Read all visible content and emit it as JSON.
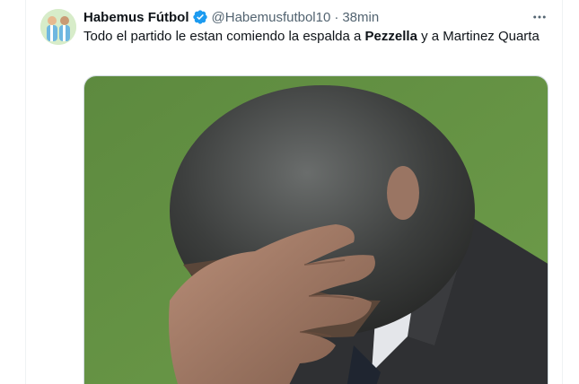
{
  "tweet": {
    "author_name": "Habemus Fútbol",
    "handle": "@Habemusfutbol10",
    "separator": "·",
    "time": "38min",
    "text_before": "Todo el partido le estan comiendo la espalda a ",
    "text_bold": "Pezzella",
    "text_after": " y a Martinez Quarta"
  },
  "icons": {
    "verified": "verified-badge-icon",
    "more": "more-options-icon"
  },
  "colors": {
    "verified_blue": "#1d9bf0",
    "secondary_text": "#536471",
    "border": "#cfd9de"
  }
}
